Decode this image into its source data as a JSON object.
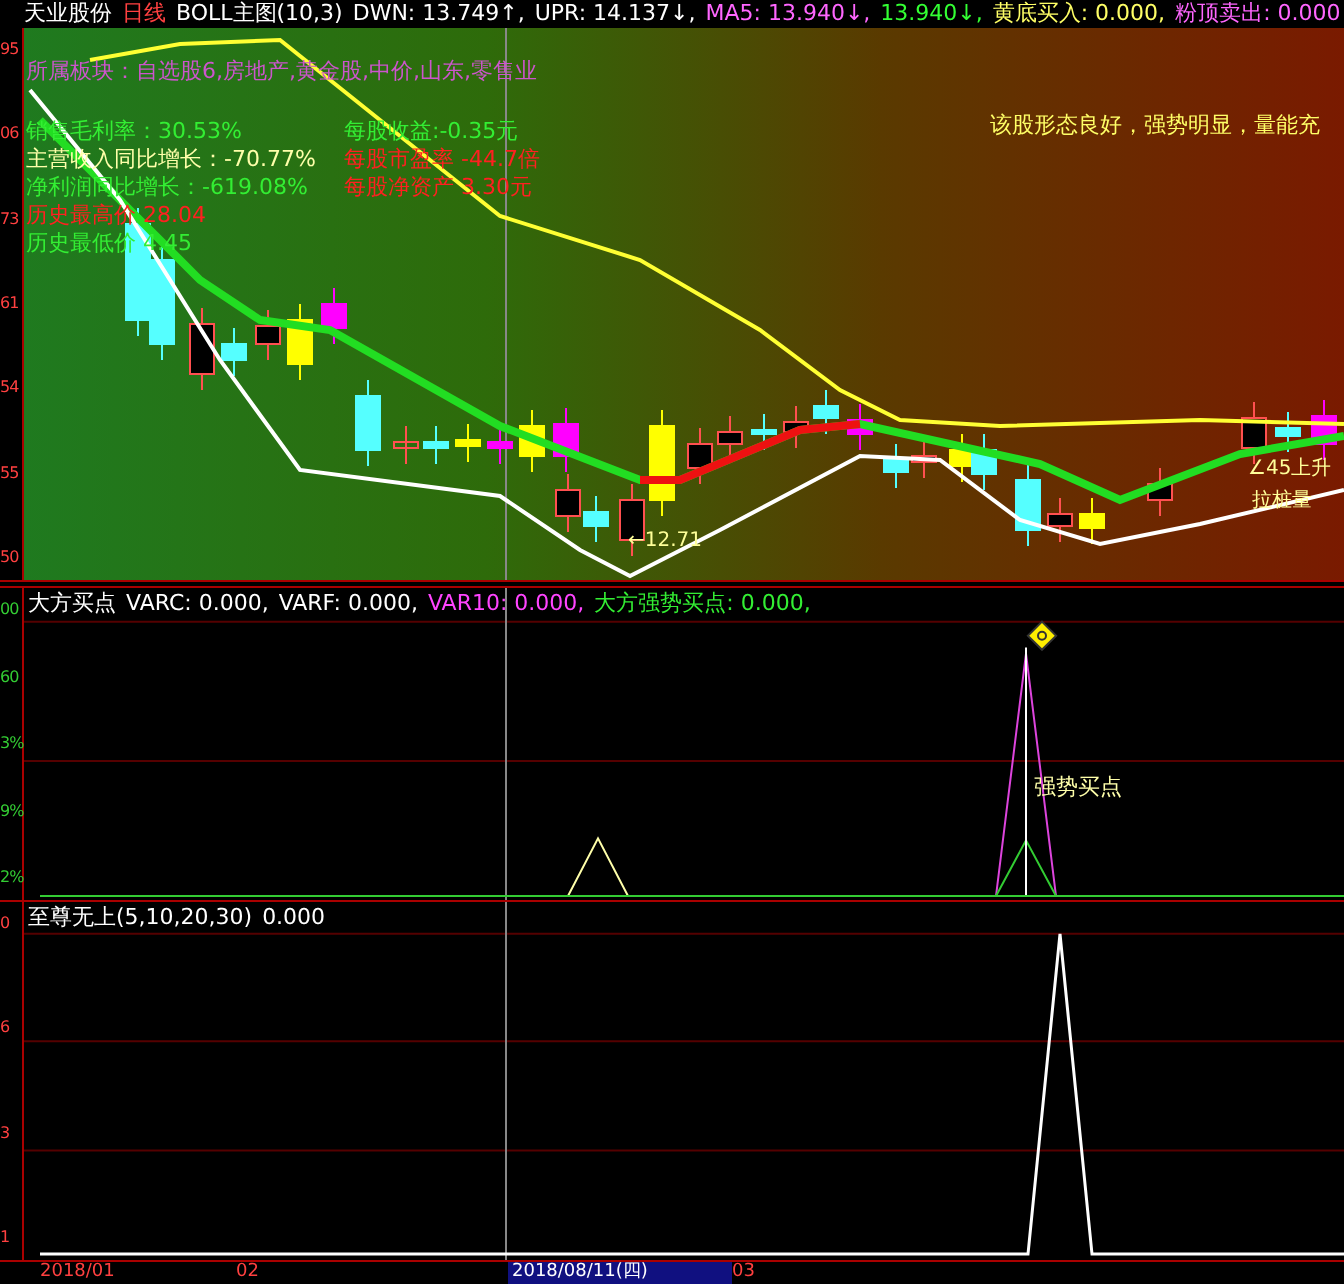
{
  "header": {
    "items": [
      {
        "text": "天业股份",
        "color": "#ffffff"
      },
      {
        "text": "日线",
        "color": "#ff4040"
      },
      {
        "text": "BOLL主图(10,3)",
        "color": "#ffffff"
      },
      {
        "text": "DWN: 13.749↑,",
        "color": "#ffffff"
      },
      {
        "text": "UPR: 14.137↓,",
        "color": "#ffffff"
      },
      {
        "text": "MA5: 13.940↓,",
        "color": "#ff66ff"
      },
      {
        "text": "13.940↓,",
        "color": "#33ff33"
      },
      {
        "text": "黄底买入: 0.000,",
        "color": "#ffff66"
      },
      {
        "text": "粉顶卖出: 0.000",
        "color": "#ff66ff"
      }
    ]
  },
  "main_chart": {
    "price_axis": [
      "95",
      "06",
      "73",
      "61",
      "54",
      "55",
      "50"
    ],
    "info_rows": [
      [
        {
          "text": "所属板块：自选股6,房地产,黄金股,中价,山东,零售业",
          "color": "#cc55cc"
        }
      ],
      [
        {
          "text": "销售毛利率：30.53%",
          "color": "#33ee33"
        },
        {
          "text": "每股收益:-0.35元",
          "color": "#33ee33"
        }
      ],
      [
        {
          "text": "主营收入同比增长：-70.77%",
          "color": "#ffffaa"
        },
        {
          "text": "每股市盈率 -44.7倍",
          "color": "#ff2020"
        }
      ],
      [
        {
          "text": "净利润同比增长：-619.08%",
          "color": "#33ee33"
        },
        {
          "text": "每股净资产 3.30元",
          "color": "#ff2020"
        }
      ],
      [
        {
          "text": "历史最高价 28.04",
          "color": "#ff2020"
        }
      ],
      [
        {
          "text": "历史最低价 4.45",
          "color": "#33ee33"
        }
      ]
    ],
    "message": "该股形态良好，强势明显，量能充",
    "annotations": [
      "←12.71",
      "∠45上升",
      "拉桩量"
    ]
  },
  "panel_1": {
    "axis": [
      "00",
      "60",
      "3%",
      "9%",
      "2%"
    ],
    "legend": [
      {
        "text": "大方买点",
        "color": "#ffffff"
      },
      {
        "text": "VARC: 0.000,",
        "color": "#ffffff"
      },
      {
        "text": "VARF: 0.000,",
        "color": "#ffffff"
      },
      {
        "text": "VAR10: 0.000,",
        "color": "#ff44ff"
      },
      {
        "text": "大方强势买点: 0.000,",
        "color": "#33ee33"
      }
    ],
    "signal_label": "强势买点"
  },
  "panel_2": {
    "axis": [
      "0",
      "6",
      "3",
      "1"
    ],
    "legend": [
      {
        "text": "至尊无上(5,10,20,30)",
        "color": "#ffffff"
      },
      {
        "text": "0.000",
        "color": "#ffffff"
      }
    ]
  },
  "date_axis": [
    {
      "text": "2018/01",
      "selected": false
    },
    {
      "text": "02",
      "selected": false
    },
    {
      "text": "2018/08/11(四)",
      "selected": true
    },
    {
      "text": "03",
      "selected": false
    }
  ]
}
